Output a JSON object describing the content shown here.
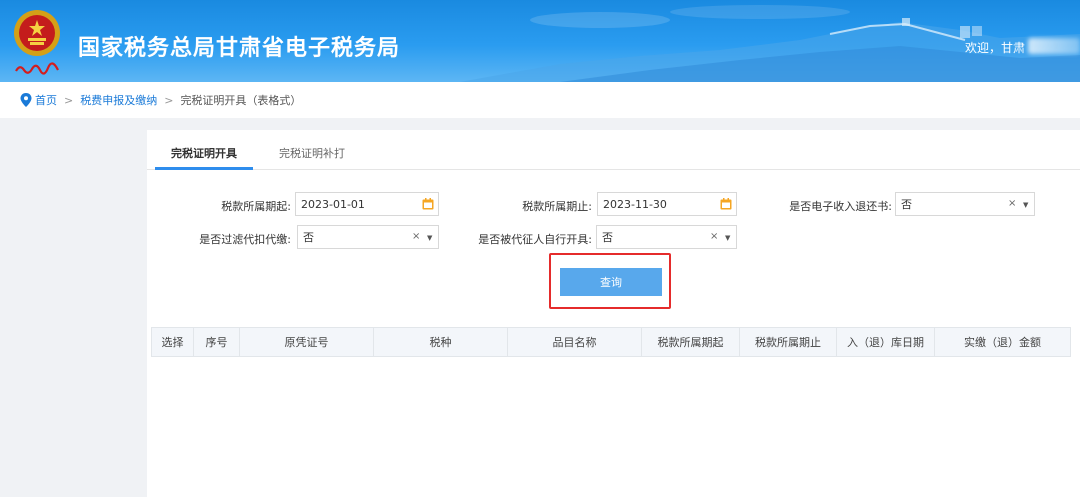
{
  "header": {
    "title": "国家税务总局甘肃省电子税务局",
    "welcome": "欢迎，甘肃",
    "emblem_caption": "中国税务",
    "colors": {
      "primary": "#2a9cf0",
      "highlight": "#e52b2b"
    }
  },
  "breadcrumb": {
    "home": "首页",
    "level2": "税费申报及缴纳",
    "current": "完税证明开具（表格式）",
    "separator": ">"
  },
  "tabs": [
    {
      "label": "完税证明开具",
      "active": true
    },
    {
      "label": "完税证明补打",
      "active": false
    }
  ],
  "form": {
    "period_start": {
      "label": "税款所属期起:",
      "value": "2023-01-01"
    },
    "period_end": {
      "label": "税款所属期止:",
      "value": "2023-11-30"
    },
    "e_refund": {
      "label": "是否电子收入退还书:",
      "value": "否"
    },
    "filter_withhold": {
      "label": "是否过滤代扣代缴:",
      "value": "否"
    },
    "agent_issue": {
      "label": "是否被代征人自行开具:",
      "value": "否"
    },
    "clear_symbol": "×",
    "query_button": "查询"
  },
  "table": {
    "columns": [
      "选择",
      "序号",
      "原凭证号",
      "税种",
      "品目名称",
      "税款所属期起",
      "税款所属期止",
      "入（退）库日期",
      "实缴（退）金额"
    ]
  }
}
